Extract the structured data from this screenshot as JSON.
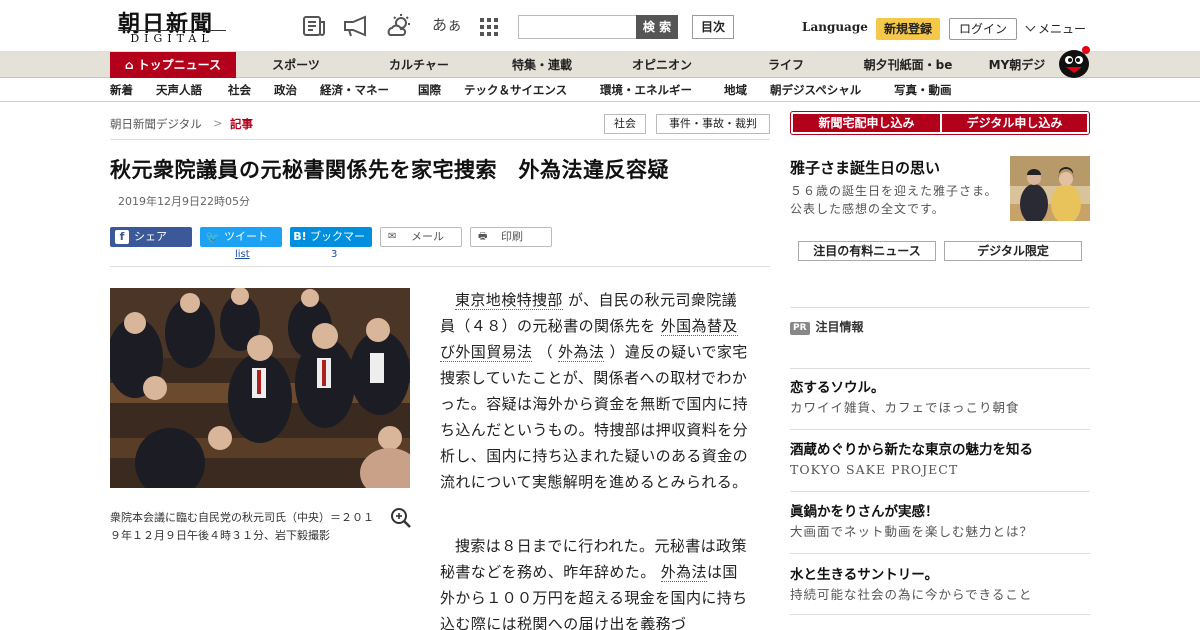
{
  "header": {
    "logo_main": "朝日新聞",
    "logo_sub": "DIGITAL",
    "icons": [
      "newspaper-icon",
      "megaphone-icon",
      "weather-icon",
      "font-size-icon",
      "grid-menu-icon"
    ],
    "font_size_label": "あぁ",
    "search_button": "検 索",
    "toc_button": "目次",
    "language": "Language",
    "register": "新規登録",
    "login": "ログイン",
    "menu": "メニュー"
  },
  "nav": {
    "items": [
      "トップニュース",
      "スポーツ",
      "カルチャー",
      "特集・連載",
      "オピニオン",
      "ライフ",
      "朝夕刊紙面・be",
      "MY朝デジ"
    ]
  },
  "subnav": {
    "items": [
      "新着",
      "天声人語",
      "社会",
      "政治",
      "経済・マネー",
      "国際",
      "テック＆サイエンス",
      "環境・エネルギー",
      "地域",
      "朝デジスペシャル",
      "写真・動画"
    ]
  },
  "breadcrumb": {
    "home": "朝日新聞デジタル",
    "sep": ">",
    "current": "記事"
  },
  "tags": [
    "社会",
    "事件・事故・裁判"
  ],
  "article": {
    "title": "秋元衆院議員の元秘書関係先を家宅捜索　外為法違反容疑",
    "date": "2019年12月9日22時05分",
    "share": {
      "facebook": "シェア",
      "twitter": "ツイート",
      "hatena": "ブックマーク",
      "mail": "メール",
      "print": "印刷",
      "twitter_count": "list",
      "hatena_count": "3"
    },
    "caption": "衆院本会議に臨む自民党の秋元司氏（中央）＝２０１９年１２月９日午後４時３１分、岩下毅撮影",
    "p1": {
      "a": "東京地検特捜部",
      "b": "が、自民の秋元司衆院議員（４８）の元秘書の関係先を",
      "c": "外国為替及び外国貿易法",
      "d": "（",
      "e": "外為法",
      "f": "）違反の疑いで家宅捜索していたことが、関係者への取材でわかった。容疑は海外から資金を無断で国内に持ち込んだというもの。特捜部は押収資料を分析し、国内に持ち込まれた疑いのある資金の流れについて実態解明を進めるとみられる。"
    },
    "p2": {
      "a": "捜索は８日までに行われた。元秘書は政策秘書などを務め、昨年辞めた。",
      "b": "外為法",
      "c": "は国外から１００万円を超える現金を国内に持ち込む際には税関への届け出を義務づ"
    }
  },
  "sidebar": {
    "buttons": [
      "新聞宅配申し込み",
      "デジタル申し込み"
    ],
    "feature": {
      "title": "雅子さま誕生日の思い",
      "desc": "５６歳の誕生日を迎えた雅子さま。公表した感想の全文です。"
    },
    "tabs": [
      "注目の有料ニュース",
      "デジタル限定"
    ],
    "pr_badge": "PR",
    "pr_label": "注目情報",
    "ads": [
      {
        "title": "恋するソウル。",
        "desc": "カワイイ雑貨、カフェでほっこり朝食"
      },
      {
        "title": "酒蔵めぐりから新たな東京の魅力を知る",
        "desc": "TOKYO SAKE PROJECT"
      },
      {
        "title": "眞鍋かをりさんが実感！",
        "desc": "大画面でネット動画を楽しむ魅力とは？"
      },
      {
        "title": "水と生きるサントリー。",
        "desc": "持続可能な社会の為に今からできること"
      }
    ]
  },
  "colors": {
    "brand_red": "#b3001b",
    "facebook": "#3b5998",
    "twitter": "#1da1f2",
    "hatena": "#008fde",
    "register": "#f5c84a"
  }
}
